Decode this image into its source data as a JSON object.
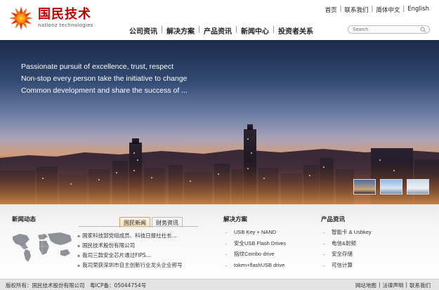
{
  "brand": {
    "name_cn": "国民技术",
    "name_en": "nationz technologies",
    "accent": "#c00000"
  },
  "toplinks": [
    {
      "label": "首页"
    },
    {
      "label": "联系我们"
    },
    {
      "label": "简体中文"
    },
    {
      "label": "English"
    }
  ],
  "nav": [
    {
      "label": "公司资讯"
    },
    {
      "label": "解决方案"
    },
    {
      "label": "产品资讯"
    },
    {
      "label": "新闻中心"
    },
    {
      "label": "投资者关系"
    }
  ],
  "search": {
    "placeholder": "Search",
    "icon": "search-icon"
  },
  "banner": {
    "slogan": [
      "Passionate pursuit of excellence, trust, respect",
      "Non-stop every person take the initiative to change",
      "Common development and share the success of ..."
    ]
  },
  "news": {
    "title": "新闻动态",
    "tabs": [
      {
        "label": "国民新闻"
      },
      {
        "label": "财务资讯"
      }
    ],
    "items": [
      "国家科技部党组成员、科技日报社社长...",
      "国民技术股份有限公司",
      "我司三款安全芯片通过FIPS...",
      "我司荣获深圳市自主创新行业龙头企业称号"
    ]
  },
  "solutions": {
    "title": "解决方案",
    "items": [
      "USB Key + NAND",
      "安全USB Flash Drives",
      "指纹Combo drive",
      "token+flashUSB drive"
    ]
  },
  "products": {
    "title": "产品资讯",
    "items": [
      "智能卡 & Usbkey",
      "电信&射频",
      "安全存储",
      "可信计算"
    ]
  },
  "footer": {
    "copyright": "版权所有：国民技术股份有限公司　粤ICP备：05044754号",
    "links": [
      {
        "label": "网站地图"
      },
      {
        "label": "法律声明"
      },
      {
        "label": "联系我们"
      }
    ]
  }
}
